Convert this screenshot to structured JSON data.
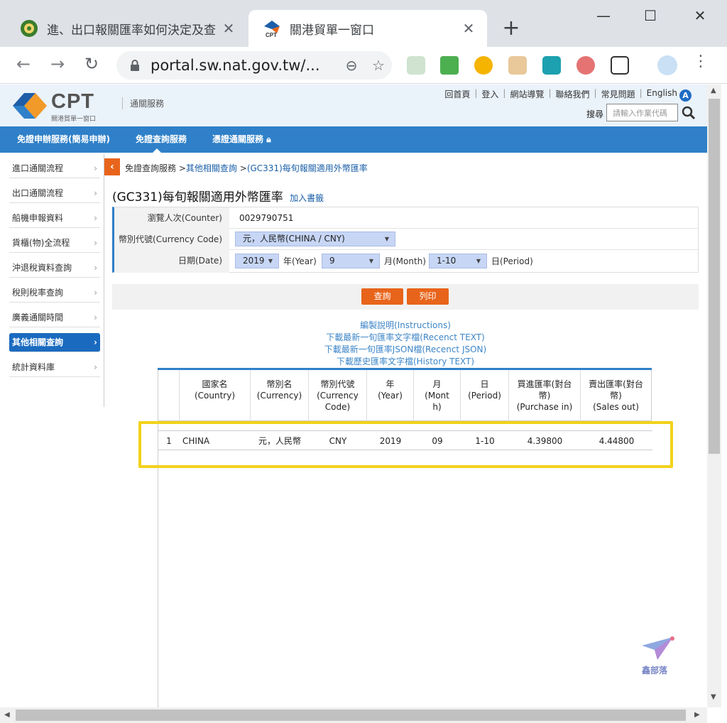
{
  "browser": {
    "tabs": [
      {
        "title": "進、出口報關匯率如何決定及查",
        "close": "✕"
      },
      {
        "title": "關港貿單一窗口",
        "close": "✕"
      }
    ],
    "new_tab": "+",
    "url": "portal.sw.nat.gov.tw/...",
    "window_controls": {
      "minimize": "—",
      "maximize": "☐",
      "close": "✕"
    }
  },
  "header": {
    "logo_text": "CPT",
    "logo_sub": "關港貿單一窗口",
    "service": "通關服務",
    "top_links": [
      "回首頁",
      "登入",
      "網站導覽",
      "聯絡我們",
      "常見問題",
      "English"
    ],
    "lang_badge": "A",
    "search_label": "搜尋",
    "search_placeholder": "請輸入作業代碼"
  },
  "main_nav": [
    "免證申辦服務(簡易申辦)",
    "免證查詢服務",
    "憑證通關服務"
  ],
  "sidebar": [
    "進口通關流程",
    "出口通關流程",
    "船機申報資料",
    "貨櫃(物)全流程",
    "沖退稅資料查詢",
    "稅則稅率查詢",
    "廣義通關時間",
    "其他相關查詢",
    "統計資料庫"
  ],
  "breadcrumb": {
    "home": "免證查詢服務",
    "sep": ">",
    "level2": "其他相關查詢",
    "level3": "(GC331)每旬報關適用外幣匯率"
  },
  "page_title": "(GC331)每旬報關適用外幣匯率",
  "bookmark_label": "加入書籤",
  "form": {
    "counter_label": "瀏覽人次(Counter)",
    "counter_value": "0029790751",
    "currency_label": "幣別代號(Currency Code)",
    "currency_value": "元，人民幣(CHINA / CNY)",
    "date_label": "日期(Date)",
    "year_value": "2019",
    "year_unit": "年(Year)",
    "month_value": "9",
    "month_unit": "月(Month)",
    "period_value": "1-10",
    "period_unit": "日(Period)"
  },
  "buttons": {
    "query": "查詢",
    "print": "列印"
  },
  "links": [
    "編製說明(Instructions)",
    "下載最新一旬匯率文字檔(Recenct TEXT)",
    "下載最新一旬匯率JSON檔(Recenct JSON)",
    "下載歷史匯率文字檔(History TEXT)"
  ],
  "table": {
    "headers": [
      [
        "國家名",
        "(Country)"
      ],
      [
        "幣別名",
        "(Currency)"
      ],
      [
        "幣別代號",
        "(Currency",
        "Code)"
      ],
      [
        "年",
        "(Year)"
      ],
      [
        "月",
        "(Mont",
        "h)"
      ],
      [
        "日",
        "(Period)"
      ],
      [
        "買進匯率(對台",
        "幣)",
        "(Purchase in)"
      ],
      [
        "賣出匯率(對台",
        "幣)",
        "(Sales out)"
      ]
    ],
    "rows": [
      [
        "1",
        "CHINA",
        "元，人民幣",
        "CNY",
        "2019",
        "09",
        "1-10",
        "4.39800",
        "4.44800"
      ]
    ]
  },
  "watermark": "鑫部落",
  "colors": {
    "nav_blue": "#2f80c8",
    "accent_orange": "#e8641b",
    "highlight": "#f2d21a"
  }
}
